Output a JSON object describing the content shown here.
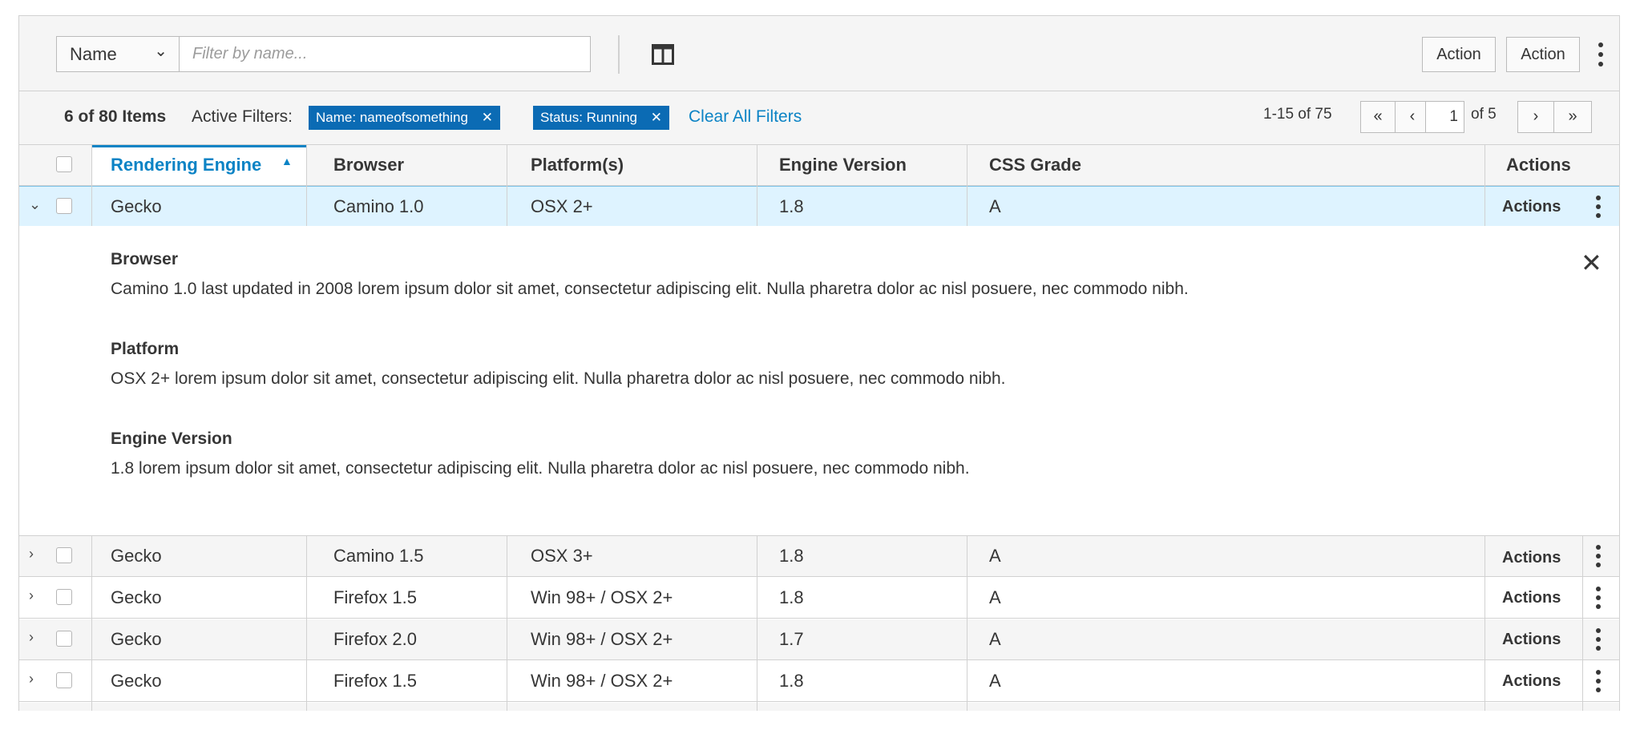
{
  "toolbar": {
    "filter_field": "Name",
    "filter_placeholder": "Filter by name...",
    "action1": "Action",
    "action2": "Action",
    "icons": {
      "columns": "columns-icon",
      "chevron": "chevron-down-icon",
      "kebab": "kebab-icon"
    }
  },
  "filters": {
    "count": "6 of 80 Items",
    "active_label": "Active Filters:",
    "chips": [
      {
        "label": "Name:",
        "value": "nameofsomething"
      },
      {
        "label": "Status:",
        "value": "Running"
      }
    ],
    "clear_all": "Clear All Filters"
  },
  "pagination": {
    "range": "1-15 of 75",
    "first": "«",
    "prev": "‹",
    "current": "1",
    "of_pages": "of 5",
    "next": "›",
    "last": "»"
  },
  "table": {
    "columns": [
      "Rendering Engine",
      "Browser",
      "Platform(s)",
      "Engine Version",
      "CSS Grade",
      "Actions"
    ],
    "sorted_column": "Rendering Engine",
    "sort_direction": "ascending",
    "rows": [
      {
        "engine": "Gecko",
        "browser": "Camino 1.0",
        "platform": "OSX 2+",
        "version": "1.8",
        "grade": "A",
        "actions": "Actions",
        "expanded": true
      },
      {
        "engine": "Gecko",
        "browser": "Camino 1.5",
        "platform": "OSX 3+",
        "version": "1.8",
        "grade": "A",
        "actions": "Actions",
        "expanded": false
      },
      {
        "engine": "Gecko",
        "browser": "Firefox 1.5",
        "platform": "Win 98+ / OSX 2+",
        "version": "1.8",
        "grade": "A",
        "actions": "Actions",
        "expanded": false
      },
      {
        "engine": "Gecko",
        "browser": "Firefox 2.0",
        "platform": "Win 98+ / OSX 2+",
        "version": "1.7",
        "grade": "A",
        "actions": "Actions",
        "expanded": false
      },
      {
        "engine": "Gecko",
        "browser": "Firefox 1.5",
        "platform": "Win 98+ / OSX 2+",
        "version": "1.8",
        "grade": "A",
        "actions": "Actions",
        "expanded": false
      }
    ],
    "expanded_detail": {
      "close": "✕",
      "sections": [
        {
          "title": "Browser",
          "text": "Camino 1.0 last updated in 2008 lorem ipsum dolor sit amet, consectetur adipiscing elit. Nulla pharetra dolor ac nisl posuere, nec commodo nibh."
        },
        {
          "title": "Platform",
          "text": "OSX 2+ lorem ipsum dolor sit amet, consectetur adipiscing elit. Nulla pharetra dolor ac nisl posuere, nec commodo nibh."
        },
        {
          "title": "Engine Version",
          "text": "1.8 lorem ipsum dolor sit amet, consectetur adipiscing elit. Nulla pharetra dolor ac nisl posuere, nec commodo nibh."
        }
      ]
    }
  },
  "colors": {
    "accent": "#0b83c5",
    "chip": "#0b6bb4",
    "selected_row": "#def3ff",
    "striped_row": "#f5f5f5",
    "border": "#d1d1d1"
  }
}
